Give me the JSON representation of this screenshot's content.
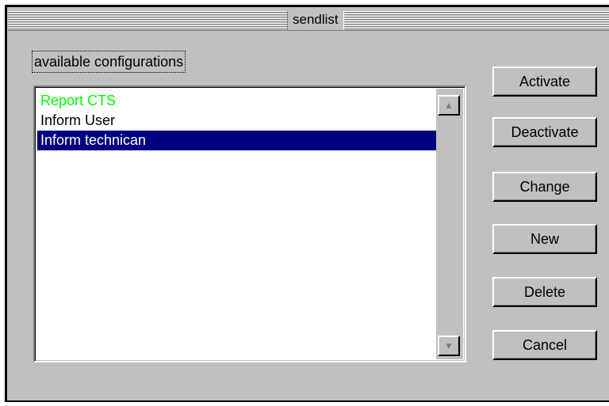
{
  "window": {
    "title": "sendlist"
  },
  "group": {
    "label": "available configurations"
  },
  "list": {
    "items": [
      {
        "label": "Report CTS",
        "state": "active",
        "color": "#00ff00"
      },
      {
        "label": "Inform User",
        "state": "normal"
      },
      {
        "label": "Inform technican",
        "state": "selected"
      }
    ],
    "selected_color": "#000080"
  },
  "buttons": {
    "activate": "Activate",
    "deactivate": "Deactivate",
    "change": "Change",
    "new": "New",
    "delete": "Delete",
    "cancel": "Cancel"
  },
  "icons": {
    "scroll_up": "triangle-up",
    "scroll_down": "triangle-down"
  }
}
